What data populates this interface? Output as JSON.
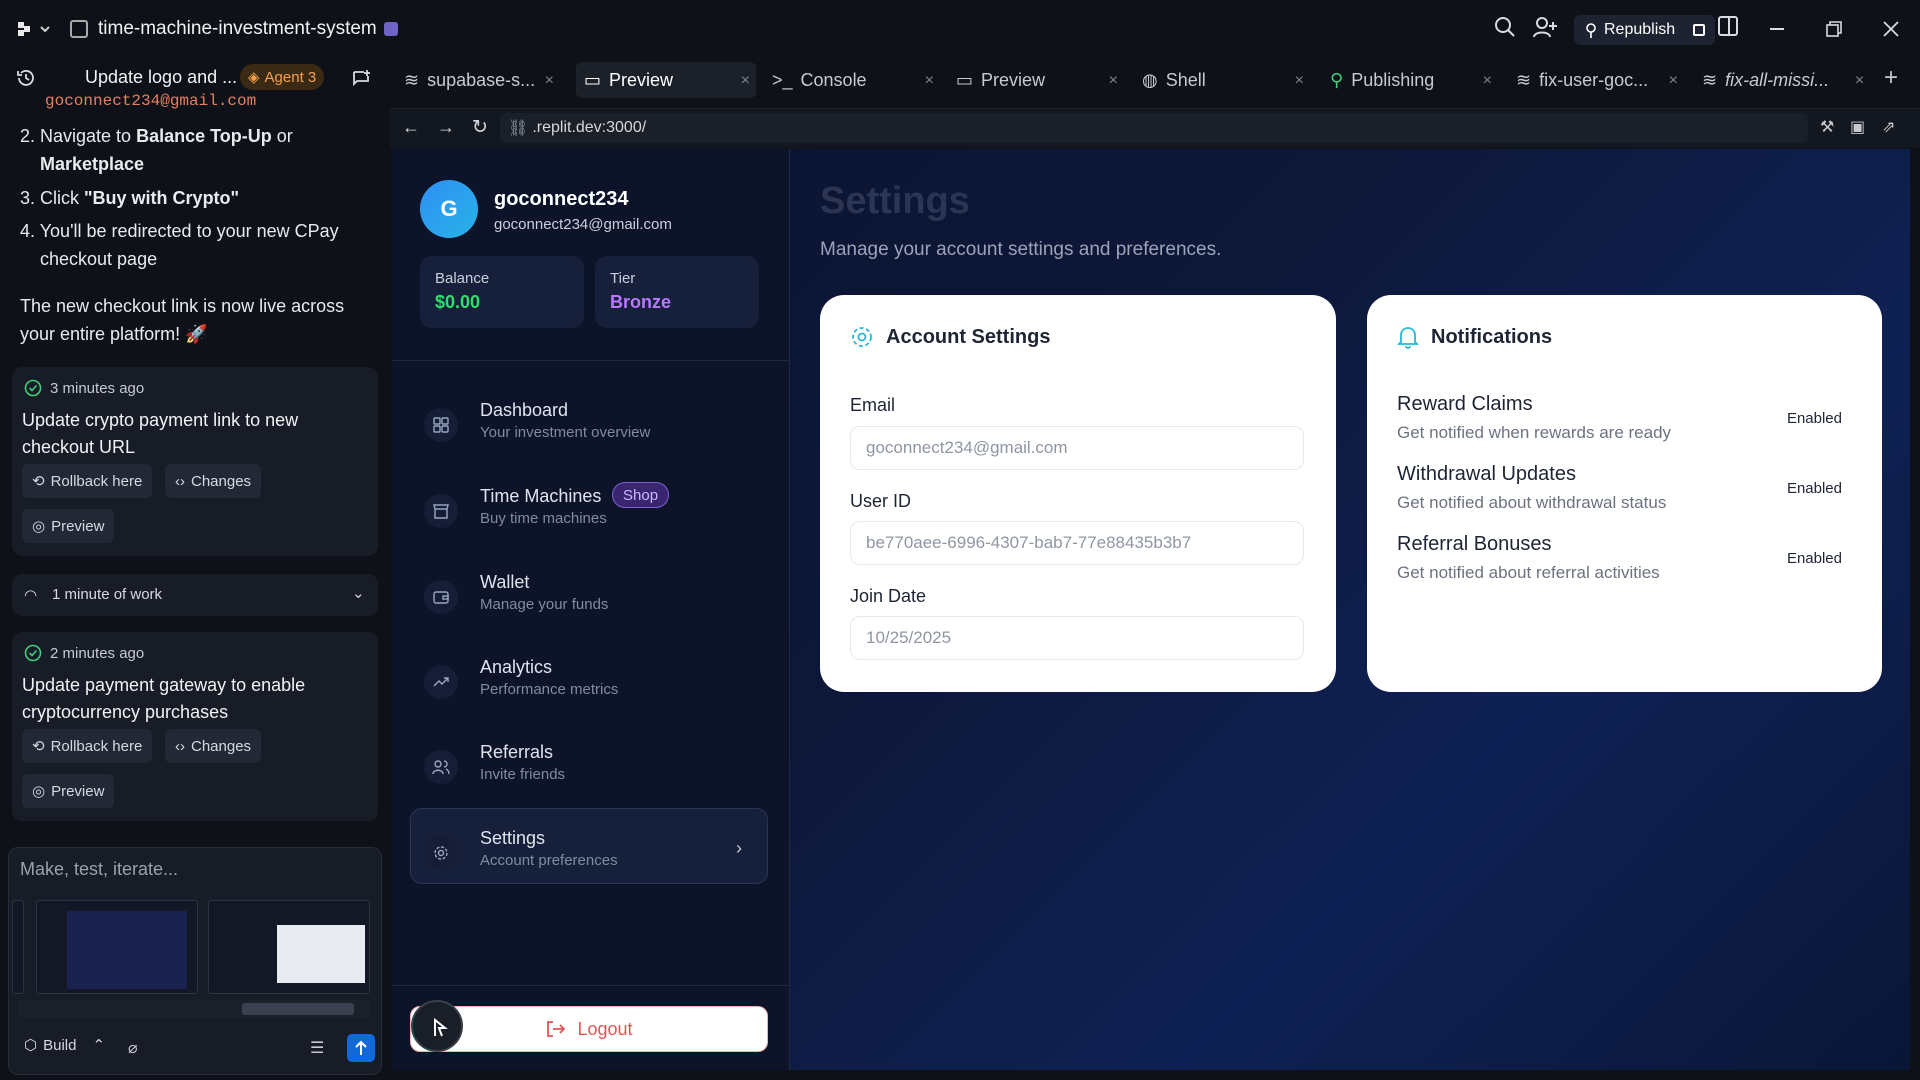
{
  "window": {
    "project_title": "time-machine-investment-system"
  },
  "toolbar": {
    "republish_label": "Republish"
  },
  "agent": {
    "title": "Update logo and ...",
    "badge": "Agent 3"
  },
  "chat": {
    "email_code": "goconnect234@gmail.com",
    "step2_prefix": "2. Navigate to ",
    "step2_bold1": "Balance Top-Up",
    "step2_mid": " or",
    "step2_bold2": "Marketplace",
    "step3_prefix": "3. Click ",
    "step3_bold": "\"Buy with Crypto\"",
    "step4_line1": "4. You'll be redirected to your new CPay",
    "step4_line2": "checkout page",
    "live_line1": "The new checkout link is now live across",
    "live_line2": "your entire platform! 🚀"
  },
  "checkpoints": [
    {
      "time": "3 minutes ago",
      "desc": "Update crypto payment link to new checkout URL",
      "rollback": "Rollback here",
      "changes": "Changes",
      "preview": "Preview"
    },
    {
      "time": "2 minutes ago",
      "desc": "Update payment gateway to enable cryptocurrency purchases",
      "rollback": "Rollback here",
      "changes": "Changes",
      "preview": "Preview"
    }
  ],
  "work": {
    "label": "1 minute of work"
  },
  "composer": {
    "placeholder": "Make, test, iterate...",
    "build_label": "Build"
  },
  "tabs": [
    {
      "label": "supabase-s...",
      "icon": "database-icon"
    },
    {
      "label": "Preview",
      "icon": "monitor-icon"
    },
    {
      "label": "Console",
      "icon": "terminal-icon"
    },
    {
      "label": "Preview",
      "icon": "monitor-icon"
    },
    {
      "label": "Shell",
      "icon": "shell-icon"
    },
    {
      "label": "Publishing",
      "icon": "publish-icon"
    },
    {
      "label": "fix-user-goc...",
      "icon": "database-icon"
    },
    {
      "label": "fix-all-missi...",
      "icon": "database-icon"
    }
  ],
  "browser": {
    "url": ".replit.dev:3000/"
  },
  "app": {
    "user": {
      "initial": "G",
      "name": "goconnect234",
      "email": "goconnect234@gmail.com"
    },
    "balance": {
      "label": "Balance",
      "value": "$0.00"
    },
    "tier": {
      "label": "Tier",
      "value": "Bronze"
    },
    "nav": [
      {
        "title": "Dashboard",
        "sub": "Your investment overview"
      },
      {
        "title": "Time Machines",
        "sub": "Buy time machines",
        "badge": "Shop"
      },
      {
        "title": "Wallet",
        "sub": "Manage your funds"
      },
      {
        "title": "Analytics",
        "sub": "Performance metrics"
      },
      {
        "title": "Referrals",
        "sub": "Invite friends"
      },
      {
        "title": "Settings",
        "sub": "Account preferences"
      }
    ],
    "logout_label": "Logout",
    "page_title": "Settings",
    "page_subtitle": "Manage your account settings and preferences.",
    "account": {
      "title": "Account Settings",
      "email_label": "Email",
      "email_value": "goconnect234@gmail.com",
      "userid_label": "User ID",
      "userid_value": "be770aee-6996-4307-bab7-77e88435b3b7",
      "join_label": "Join Date",
      "join_value": "10/25/2025"
    },
    "notifications": {
      "title": "Notifications",
      "items": [
        {
          "title": "Reward Claims",
          "sub": "Get notified when rewards are ready",
          "status": "Enabled"
        },
        {
          "title": "Withdrawal Updates",
          "sub": "Get notified about withdrawal status",
          "status": "Enabled"
        },
        {
          "title": "Referral Bonuses",
          "sub": "Get notified about referral activities",
          "status": "Enabled"
        }
      ]
    }
  },
  "colors": {
    "accent": "#0f69d8",
    "balance": "#2ee06a",
    "tier": "#b878ff",
    "agent_badge": "#f6a14a",
    "logout": "#e25555"
  }
}
